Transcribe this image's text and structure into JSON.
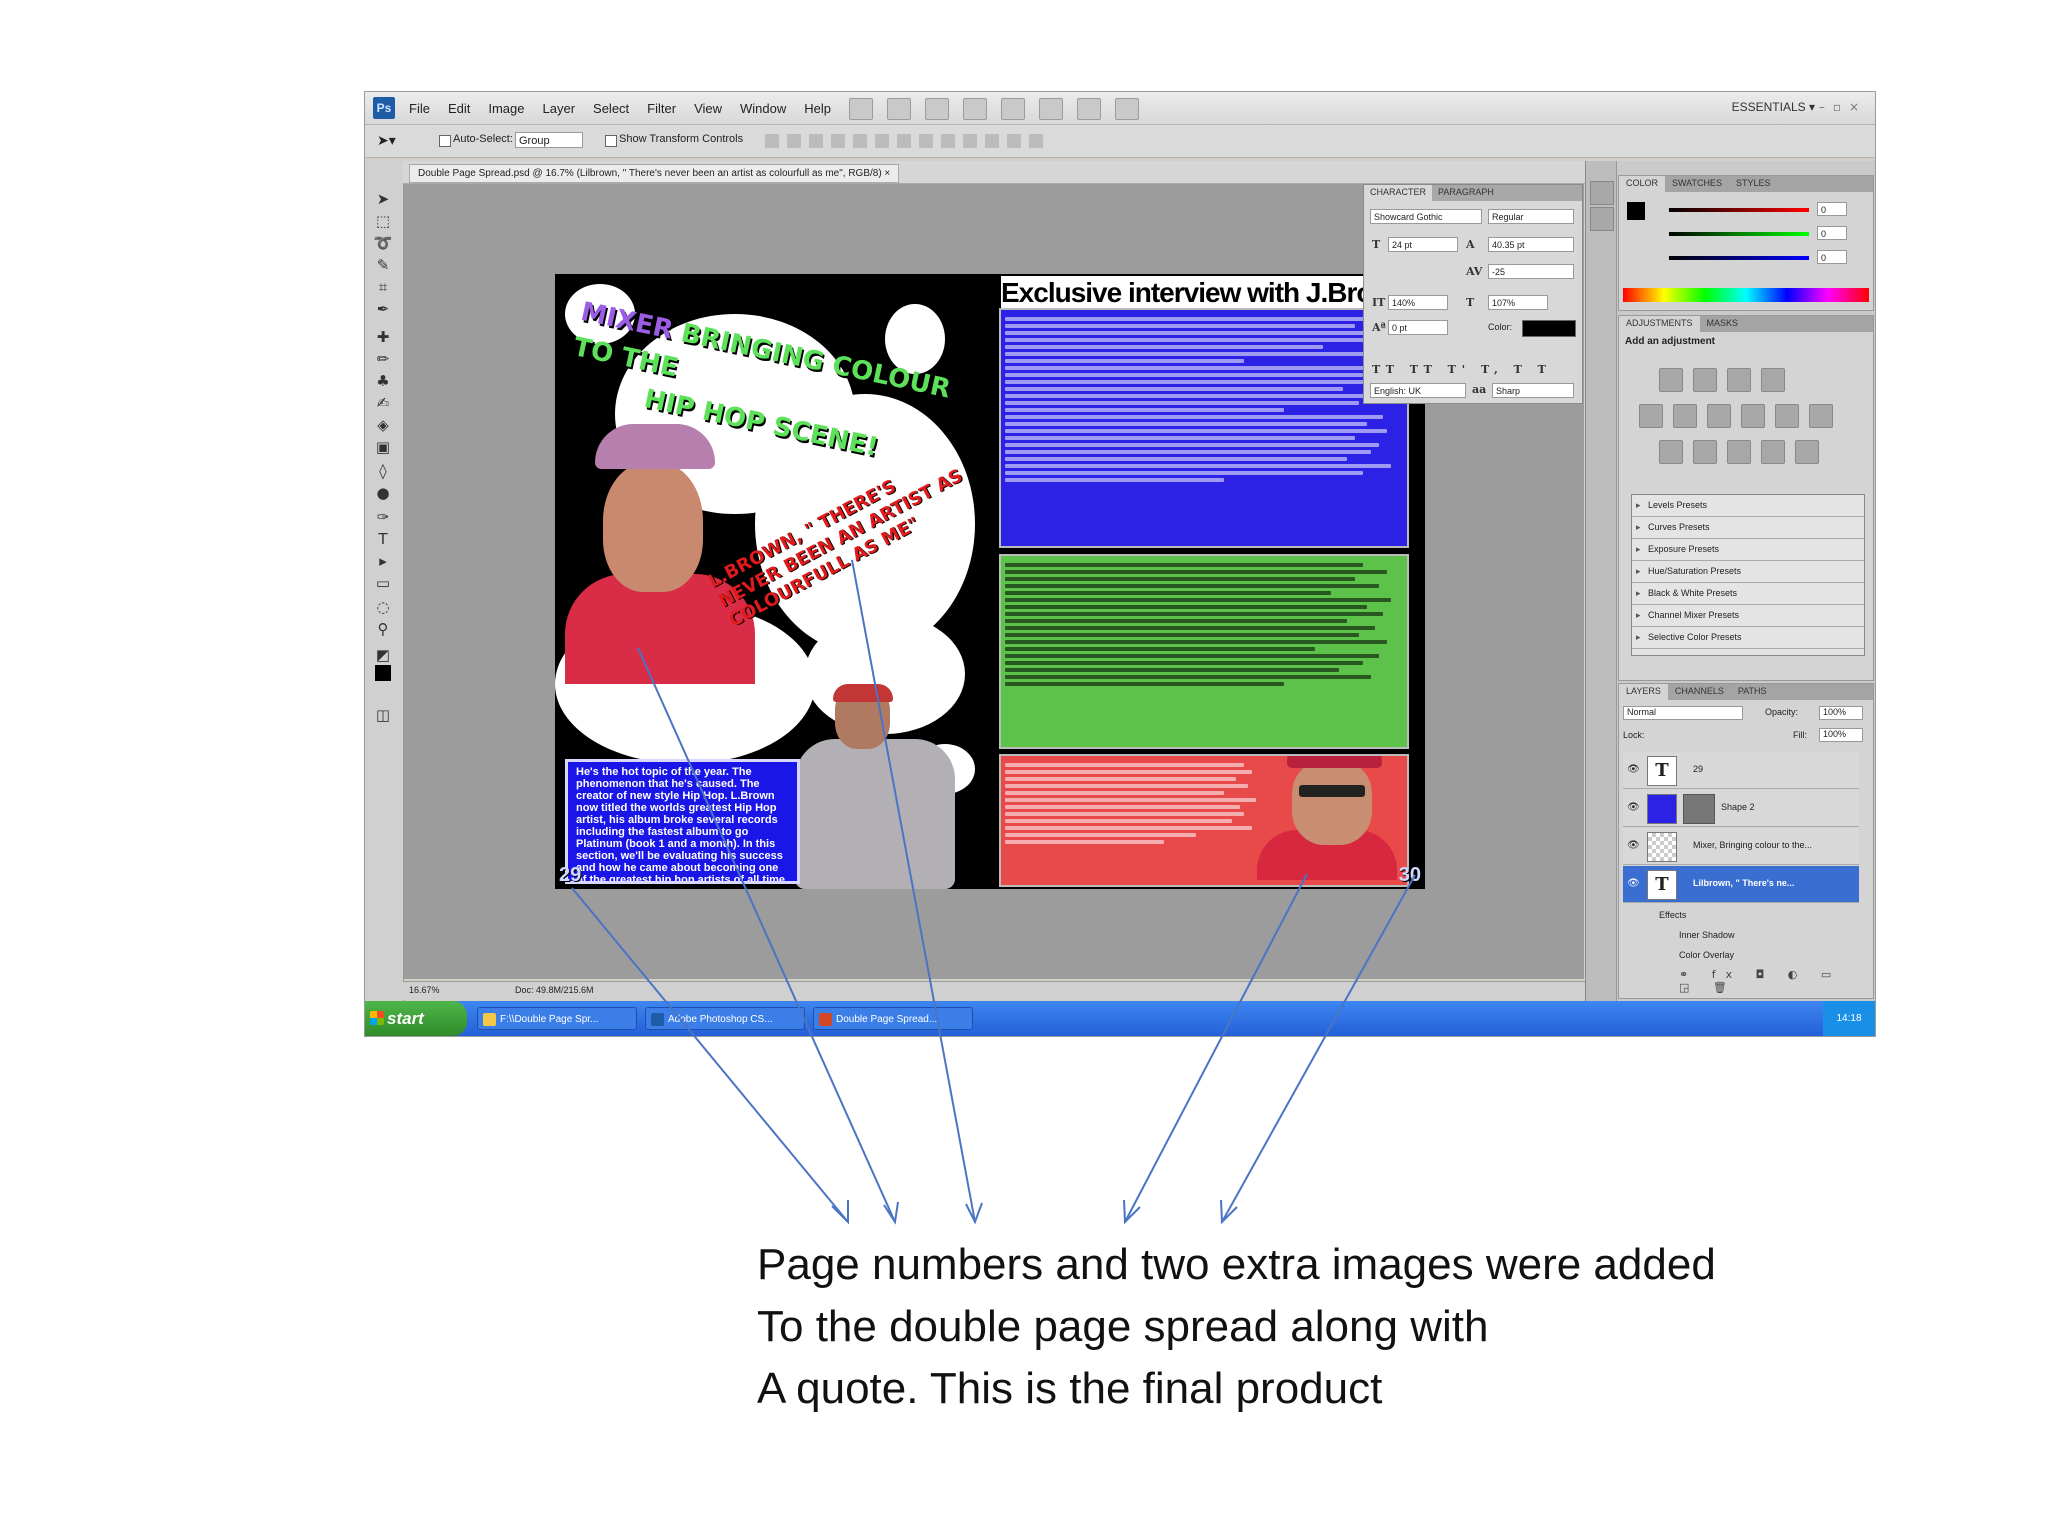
{
  "app": {
    "logo": "Ps",
    "menus": [
      "File",
      "Edit",
      "Image",
      "Layer",
      "Select",
      "Filter",
      "View",
      "Window",
      "Help"
    ],
    "workspace": "ESSENTIALS ▾",
    "window_controls": "–▫×"
  },
  "options_bar": {
    "auto_select_label": "Auto-Select:",
    "auto_select_value": "Group",
    "show_transform_label": "Show Transform Controls"
  },
  "document": {
    "tab_title": "Double Page Spread.psd @ 16.7% (Lilbrown, \" There's never been an artist as colourfull as me\", RGB/8) ×"
  },
  "spread": {
    "headline_1": "MIXER",
    "headline_2": "BRINGING COLOUR TO THE",
    "headline_3": "HIP HOP SCENE!",
    "quote": "L.BROWN, \" THERE'S NEVER BEEN AN ARTIST AS COLOURFULL AS ME\"",
    "intro_text": "He's the hot topic of the year. The phenomenon that he's caused. The creator of new style Hip Hop. L.Brown now titled the worlds greatest Hip Hop artist, his album broke several records including the fastest album to go Platinum (book 1 and a month). In this section, we'll be evaluating his success and how he came about becoming one of the greatest hip hop artists of all time",
    "page_left": "29",
    "page_right": "30",
    "right_title": "Exclusive interview with J.Brown"
  },
  "character_panel": {
    "tabs": [
      "CHARACTER",
      "PARAGRAPH"
    ],
    "font": "Showcard Gothic",
    "style": "Regular",
    "size": "24 pt",
    "leading": "40.35 pt",
    "tracking": "-25",
    "vscale": "140%",
    "hscale": "107%",
    "baseline": "0 pt",
    "color_label": "Color:",
    "language": "English: UK",
    "aa": "Sharp"
  },
  "color_panel": {
    "tabs": [
      "COLOR",
      "SWATCHES",
      "STYLES"
    ],
    "r": "0",
    "g": "0",
    "b": "0"
  },
  "adjustments_panel": {
    "tabs": [
      "ADJUSTMENTS",
      "MASKS"
    ],
    "heading": "Add an adjustment",
    "presets": [
      "Levels Presets",
      "Curves Presets",
      "Exposure Presets",
      "Hue/Saturation Presets",
      "Black & White Presets",
      "Channel Mixer Presets",
      "Selective Color Presets"
    ]
  },
  "layers_panel": {
    "tabs": [
      "LAYERS",
      "CHANNELS",
      "PATHS"
    ],
    "blend_mode": "Normal",
    "opacity_label": "Opacity:",
    "opacity": "100%",
    "lock_label": "Lock:",
    "fill_label": "Fill:",
    "fill": "100%",
    "layers": [
      {
        "name": "29",
        "thumb": "T"
      },
      {
        "name": "Shape 2",
        "thumb": ""
      },
      {
        "name": "Mixer, Bringing colour to the...",
        "thumb": ""
      },
      {
        "name": "Lilbrown, \" There's ne...",
        "thumb": "T"
      }
    ],
    "effects_label": "Effects",
    "effect_1": "Inner Shadow",
    "effect_2": "Color Overlay"
  },
  "status_bar": {
    "zoom": "16.67%",
    "doc": "Doc: 49.8M/215.6M"
  },
  "taskbar": {
    "start": "start",
    "tasks": [
      "F:\\\\Double Page Spr...",
      "Adobe Photoshop CS...",
      "Double Page Spread..."
    ],
    "clock": "14:18"
  },
  "caption": {
    "line1": "Page numbers and two extra images were added",
    "line2": "To the double page spread along with",
    "line3": "A quote. This is the final product"
  },
  "colors": {
    "accent_blue": "#1a16e8",
    "green_box": "#5cc24a",
    "red_box": "#e84a4a",
    "arrow": "#4a74c4"
  }
}
